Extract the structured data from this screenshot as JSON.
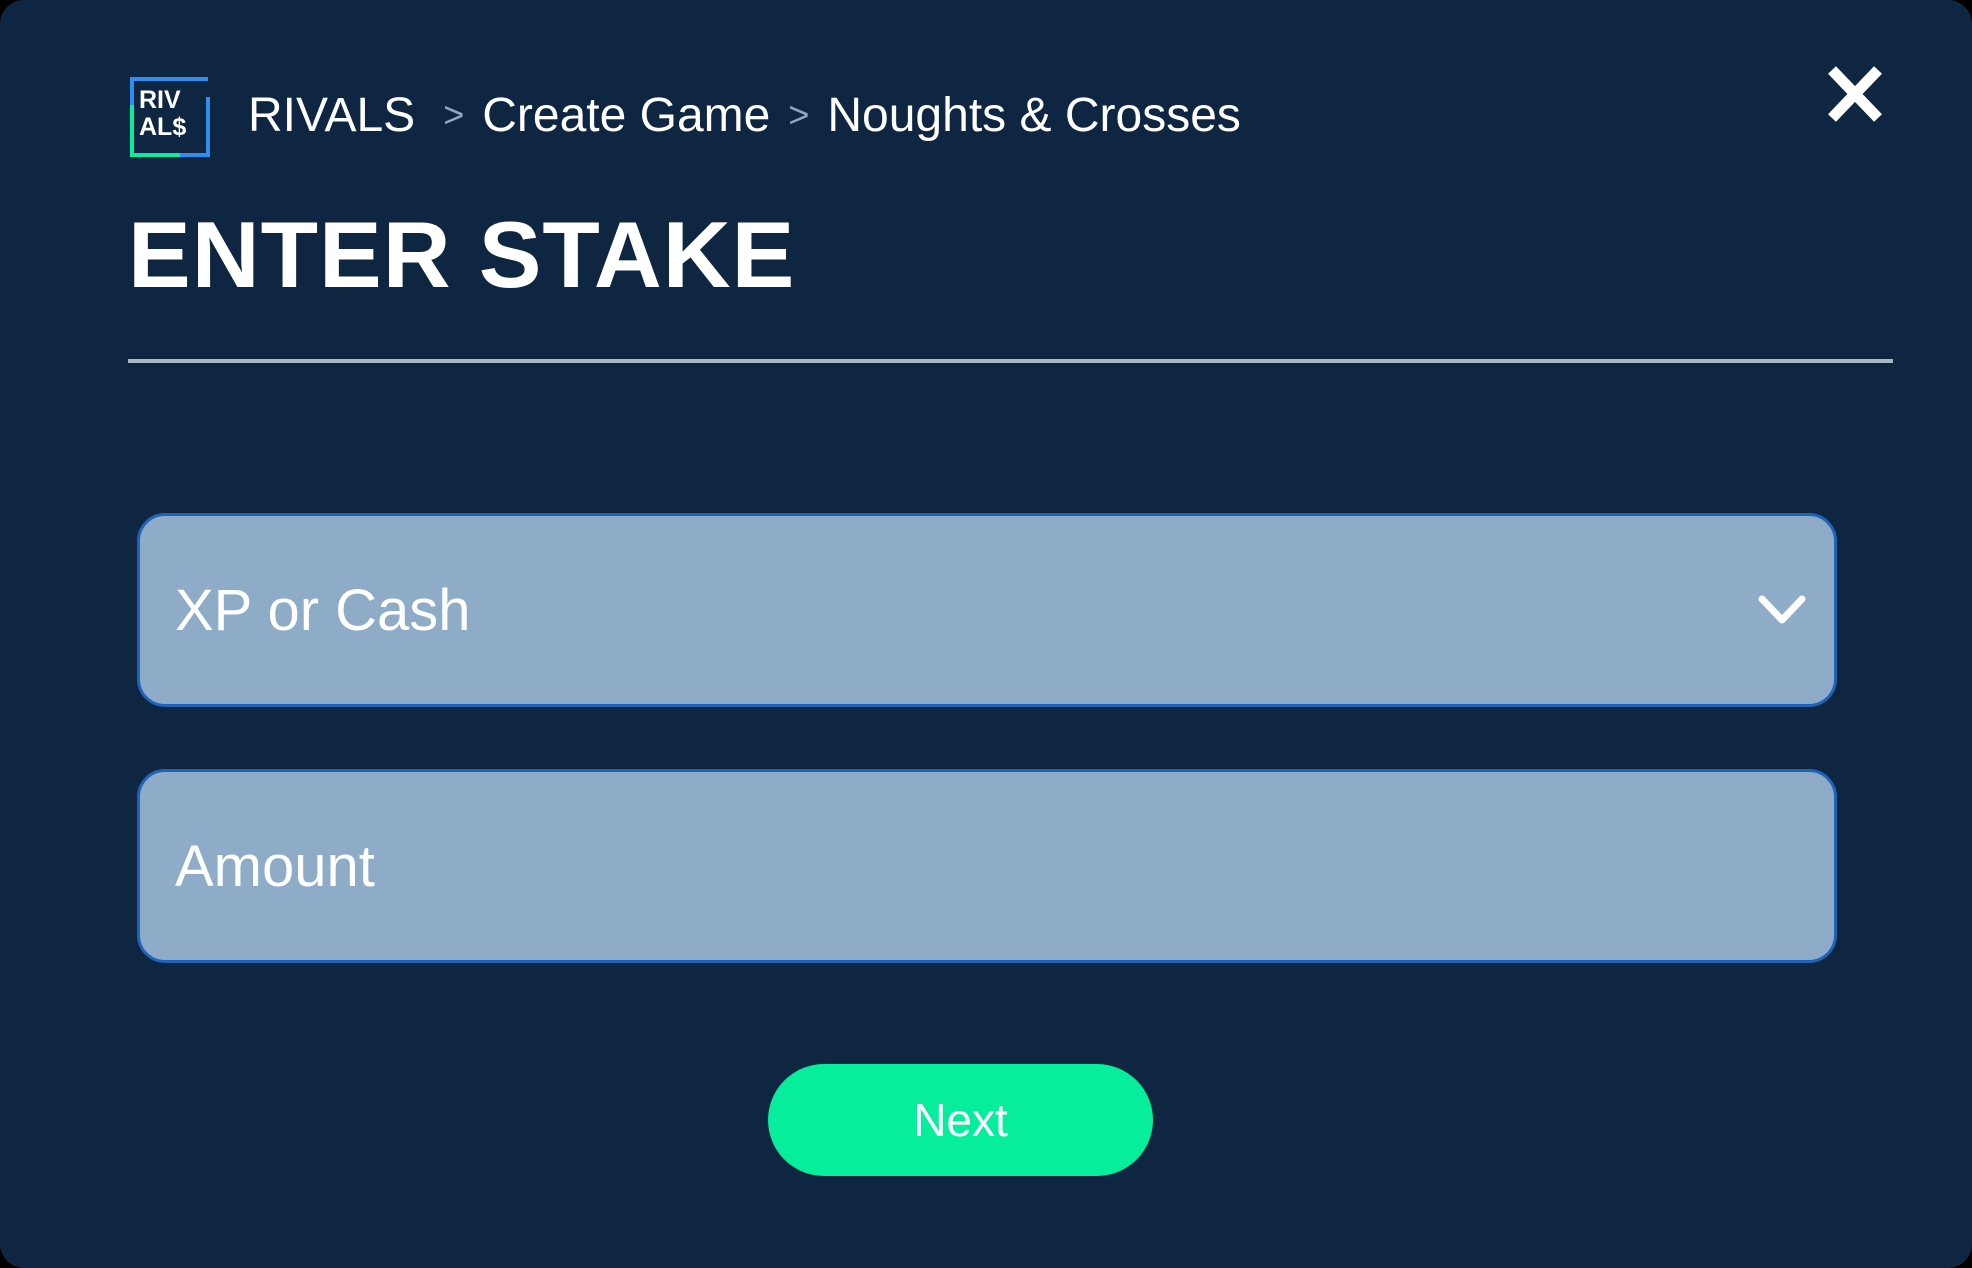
{
  "app": {
    "logo_line1": "RIV",
    "logo_line2": "AL$",
    "logo_colors": {
      "primary": "#2f8ef0",
      "accent": "#06ee9c"
    }
  },
  "breadcrumb": {
    "items": [
      "RIVALS",
      "Create Game",
      "Noughts & Crosses"
    ],
    "separator": ">"
  },
  "header": {
    "title": "ENTER STAKE",
    "close_icon": "close-icon"
  },
  "form": {
    "currency_select": {
      "placeholder": "XP or Cash",
      "icon": "chevron-down-icon"
    },
    "amount_input": {
      "placeholder": "Amount",
      "value": ""
    }
  },
  "actions": {
    "next_label": "Next"
  },
  "colors": {
    "background": "#0e2641",
    "field_fill": "#8eabc8",
    "field_border": "#1f64b7",
    "button": "#06ee9c",
    "divider": "#a9b6c4"
  }
}
